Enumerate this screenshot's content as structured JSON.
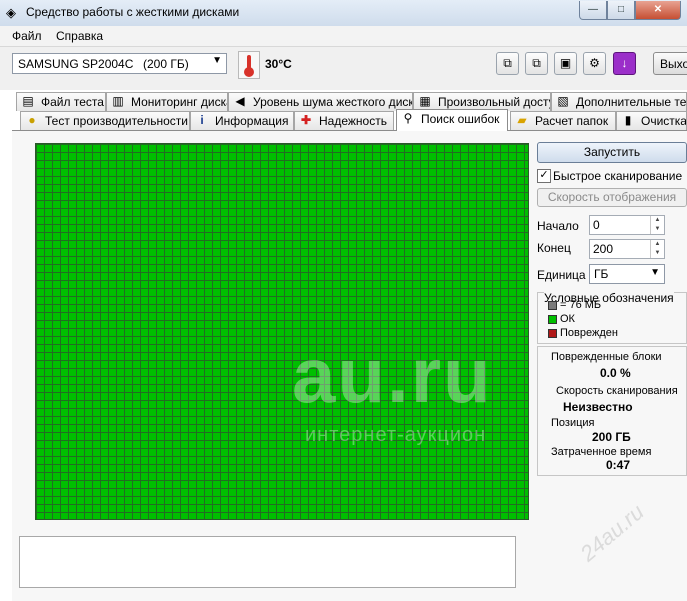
{
  "window": {
    "title": "Средство работы с жесткими дисками",
    "buttons": {
      "minimize": "—",
      "maximize": "□",
      "close": "✕"
    }
  },
  "menu": [
    "Файл",
    "Справка"
  ],
  "toolbar": {
    "drive_name": "SAMSUNG SP2004C",
    "drive_size": "(200 ГБ)",
    "temperature": "30°C",
    "exit_label": "Выхо"
  },
  "tabs_row1": [
    {
      "label": "Файл теста",
      "icon": "document-icon"
    },
    {
      "label": "Мониторинг диска",
      "icon": "chart-icon"
    },
    {
      "label": "Уровень шума жесткого диска",
      "icon": "speaker-icon"
    },
    {
      "label": "Произвольный доступ",
      "icon": "random-access-icon"
    },
    {
      "label": "Дополнительные тесты",
      "icon": "extra-tests-icon"
    }
  ],
  "tabs_row2": [
    {
      "label": "Тест производительности",
      "icon": "bulb-icon"
    },
    {
      "label": "Информация",
      "icon": "info-icon"
    },
    {
      "label": "Надежность",
      "icon": "health-cross-icon"
    },
    {
      "label": "Поиск ошибок",
      "icon": "magnifier-icon",
      "active": true
    },
    {
      "label": "Расчет папок",
      "icon": "folder-icon"
    },
    {
      "label": "Очистка",
      "icon": "trash-icon"
    }
  ],
  "panel": {
    "start_label": "Запустить",
    "quick_scan_label": "Быстрое сканирование",
    "quick_scan_checked": true,
    "display_speed_label": "Скорость отображения",
    "start_field_label": "Начало",
    "start_value": "0",
    "end_field_label": "Конец",
    "end_value": "200",
    "unit_label": "Единица",
    "unit_value": "ГБ"
  },
  "legend": {
    "title": "Условные обозначения",
    "items": [
      {
        "label": "= 76 МБ",
        "color": "#7a7a7a"
      },
      {
        "label": "ОК",
        "color": "#00bf00"
      },
      {
        "label": "Поврежден",
        "color": "#b01818"
      }
    ]
  },
  "stats": {
    "damaged_label": "Поврежденные блоки",
    "damaged_value": "0.0 %",
    "speed_label": "Скорость сканирования",
    "speed_value": "Неизвестно",
    "position_label": "Позиция",
    "position_value": "200 ГБ",
    "elapsed_label": "Затраченное время",
    "elapsed_value": "0:47"
  },
  "scan_map": {
    "status": "all blocks OK",
    "ok_color": "#00bf00",
    "grid_color": "#226c22"
  },
  "watermark": {
    "big": "au.ru",
    "small": "интернет-аукцион",
    "diag": "24au.ru"
  }
}
